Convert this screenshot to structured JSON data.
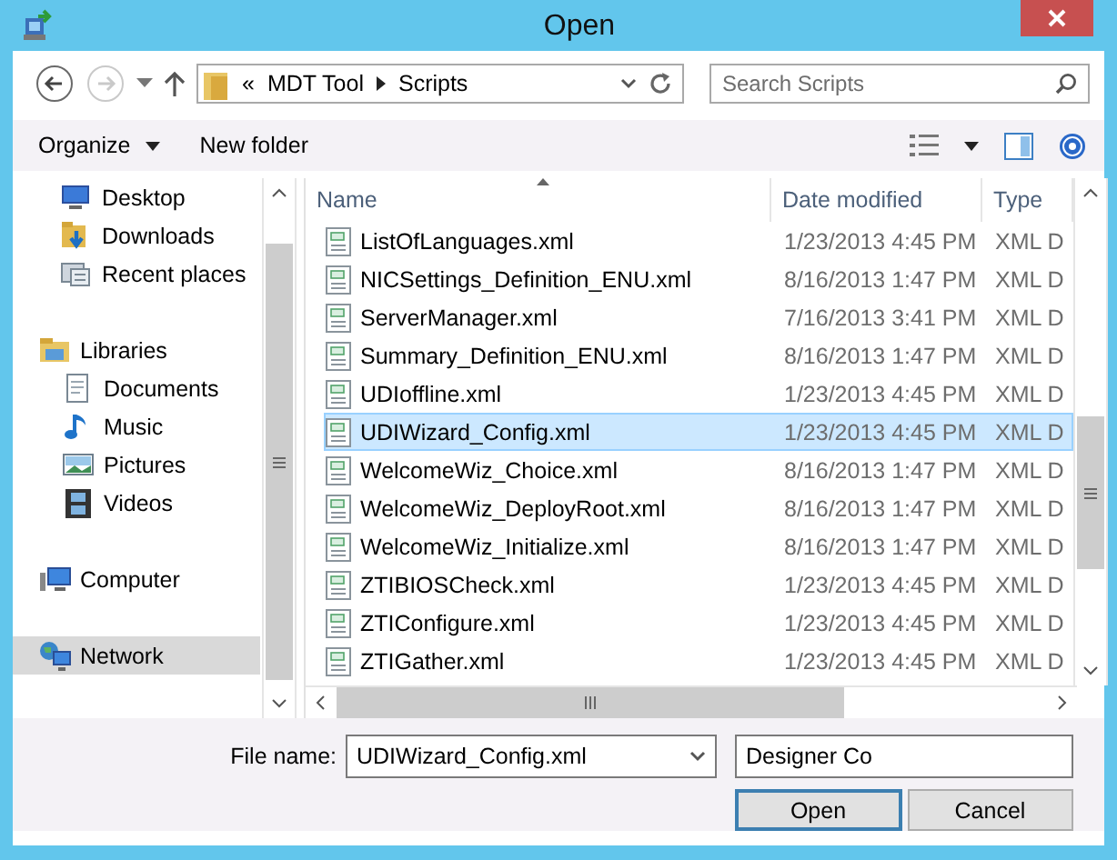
{
  "window": {
    "title": "Open"
  },
  "navigation": {
    "overflow": "«",
    "path": [
      "MDT Tool",
      "Scripts"
    ],
    "search": {
      "placeholder": "Search Scripts"
    }
  },
  "toolbar": {
    "buttons": [
      "Organize",
      "New folder"
    ]
  },
  "sidebar": {
    "items": [
      {
        "label": "Desktop",
        "kind": "desktop",
        "selected": false
      },
      {
        "label": "Downloads",
        "kind": "downloads",
        "selected": false
      },
      {
        "label": "Recent places",
        "kind": "recent",
        "selected": false
      },
      {
        "label": "Libraries",
        "kind": "libraries",
        "selected": false,
        "children": [
          {
            "label": "Documents",
            "kind": "documents",
            "selected": false
          },
          {
            "label": "Music",
            "kind": "music",
            "selected": false
          },
          {
            "label": "Pictures",
            "kind": "pictures",
            "selected": false
          },
          {
            "label": "Videos",
            "kind": "videos",
            "selected": false
          }
        ]
      },
      {
        "label": "Computer",
        "kind": "computer",
        "selected": false
      },
      {
        "label": "Network",
        "kind": "network",
        "selected": true
      }
    ]
  },
  "file_list": {
    "columns": [
      "Name",
      "Date modified",
      "Type"
    ],
    "rows": [
      {
        "name": "ListOfLanguages.xml",
        "date": "1/23/2013 4:45 PM",
        "type": "XML D",
        "selected": false
      },
      {
        "name": "NICSettings_Definition_ENU.xml",
        "date": "8/16/2013 1:47 PM",
        "type": "XML D",
        "selected": false
      },
      {
        "name": "ServerManager.xml",
        "date": "7/16/2013 3:41 PM",
        "type": "XML D",
        "selected": false
      },
      {
        "name": "Summary_Definition_ENU.xml",
        "date": "8/16/2013 1:47 PM",
        "type": "XML D",
        "selected": false
      },
      {
        "name": "UDIoffline.xml",
        "date": "1/23/2013 4:45 PM",
        "type": "XML D",
        "selected": false
      },
      {
        "name": "UDIWizard_Config.xml",
        "date": "1/23/2013 4:45 PM",
        "type": "XML D",
        "selected": true
      },
      {
        "name": "WelcomeWiz_Choice.xml",
        "date": "8/16/2013 1:47 PM",
        "type": "XML D",
        "selected": false
      },
      {
        "name": "WelcomeWiz_DeployRoot.xml",
        "date": "8/16/2013 1:47 PM",
        "type": "XML D",
        "selected": false
      },
      {
        "name": "WelcomeWiz_Initialize.xml",
        "date": "8/16/2013 1:47 PM",
        "type": "XML D",
        "selected": false
      },
      {
        "name": "ZTIBIOSCheck.xml",
        "date": "1/23/2013 4:45 PM",
        "type": "XML D",
        "selected": false
      },
      {
        "name": "ZTIConfigure.xml",
        "date": "1/23/2013 4:45 PM",
        "type": "XML D",
        "selected": false
      },
      {
        "name": "ZTIGather.xml",
        "date": "1/23/2013 4:45 PM",
        "type": "XML D",
        "selected": false
      }
    ]
  },
  "footer": {
    "file_name_label": "File name:",
    "file_name": "UDIWizard_Config.xml",
    "file_type": "Designer Co",
    "buttons": [
      "Open",
      "Cancel"
    ]
  }
}
